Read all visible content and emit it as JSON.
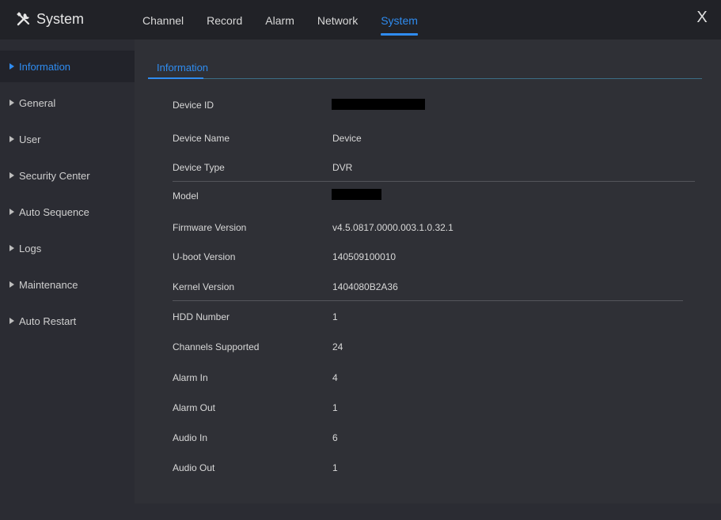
{
  "app": {
    "title": "System",
    "close_label": "X"
  },
  "tabs": [
    {
      "label": "Channel"
    },
    {
      "label": "Record"
    },
    {
      "label": "Alarm"
    },
    {
      "label": "Network"
    },
    {
      "label": "System"
    }
  ],
  "sidebar": {
    "items": [
      {
        "label": "Information"
      },
      {
        "label": "General"
      },
      {
        "label": "User"
      },
      {
        "label": "Security Center"
      },
      {
        "label": "Auto Sequence"
      },
      {
        "label": "Logs"
      },
      {
        "label": "Maintenance"
      },
      {
        "label": "Auto Restart"
      }
    ]
  },
  "content": {
    "subtab": "Information",
    "rows": [
      {
        "label": "Device ID",
        "value": ""
      },
      {
        "label": "Device Name",
        "value": "Device"
      },
      {
        "label": "Device Type",
        "value": "DVR"
      },
      {
        "label": "Model",
        "value": ""
      },
      {
        "label": "Firmware Version",
        "value": "v4.5.0817.0000.003.1.0.32.1"
      },
      {
        "label": "U-boot Version",
        "value": "140509100010"
      },
      {
        "label": "Kernel Version",
        "value": "1404080B2A36"
      },
      {
        "label": "HDD Number",
        "value": "1"
      },
      {
        "label": "Channels Supported",
        "value": "24"
      },
      {
        "label": "Alarm In",
        "value": "4"
      },
      {
        "label": "Alarm Out",
        "value": "1"
      },
      {
        "label": "Audio In",
        "value": "6"
      },
      {
        "label": "Audio Out",
        "value": "1"
      }
    ]
  },
  "colors": {
    "accent": "#2f8cf0",
    "topbar": "#212227",
    "sidebar": "#2b2c33",
    "content": "#2f3036"
  }
}
